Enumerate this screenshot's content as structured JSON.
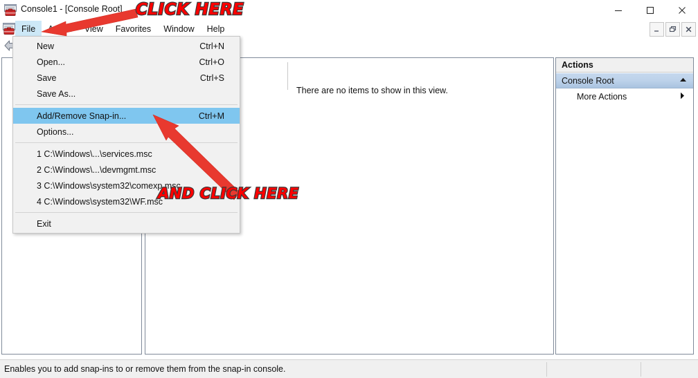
{
  "window": {
    "title": "Console1 - [Console Root]",
    "app_icon": "mmc-console-icon",
    "controls": {
      "minimize": "minimize-icon",
      "maximize": "maximize-icon",
      "close": "close-icon"
    },
    "mdi_controls": {
      "minimize": "–",
      "restore": "restore-icon",
      "close": "close-icon"
    }
  },
  "menubar": {
    "items": [
      {
        "label": "File",
        "state": "open"
      },
      {
        "label": "Action",
        "state": "normal"
      },
      {
        "label": "View",
        "state": "normal"
      },
      {
        "label": "Favorites",
        "state": "normal"
      },
      {
        "label": "Window",
        "state": "normal"
      },
      {
        "label": "Help",
        "state": "normal"
      }
    ]
  },
  "toolbar": {
    "back_icon": "back-arrow-icon",
    "folder_icon": "folder-icon"
  },
  "file_menu": {
    "groups": [
      {
        "items": [
          {
            "label": "New",
            "accel": "Ctrl+N",
            "selected": false
          },
          {
            "label": "Open...",
            "accel": "Ctrl+O",
            "selected": false
          },
          {
            "label": "Save",
            "accel": "Ctrl+S",
            "selected": false
          },
          {
            "label": "Save As...",
            "accel": "",
            "selected": false
          }
        ]
      },
      {
        "items": [
          {
            "label": "Add/Remove Snap-in...",
            "accel": "Ctrl+M",
            "selected": true
          },
          {
            "label": "Options...",
            "accel": "",
            "selected": false
          }
        ]
      },
      {
        "items": [
          {
            "label": "1 C:\\Windows\\...\\services.msc",
            "accel": "",
            "selected": false
          },
          {
            "label": "2 C:\\Windows\\...\\devmgmt.msc",
            "accel": "",
            "selected": false
          },
          {
            "label": "3 C:\\Windows\\system32\\comexp.msc",
            "accel": "",
            "selected": false
          },
          {
            "label": "4 C:\\Windows\\system32\\WF.msc",
            "accel": "",
            "selected": false
          }
        ]
      },
      {
        "items": [
          {
            "label": "Exit",
            "accel": "",
            "selected": false
          }
        ]
      }
    ]
  },
  "result_pane": {
    "empty_message": "There are no items to show in this view."
  },
  "actions_pane": {
    "title": "Actions",
    "group": {
      "label": "Console Root",
      "chevron": "▲"
    },
    "items": [
      {
        "label": "More Actions",
        "arrow": "▶"
      }
    ]
  },
  "statusbar": {
    "message": "Enables you to add snap-ins to or remove them from the snap-in console."
  },
  "annotations": [
    {
      "id": "anno1",
      "text": "CLICK HERE"
    },
    {
      "id": "anno2",
      "text": "AND CLICK HERE"
    }
  ],
  "colors": {
    "menu_selection": "#7fc6ef",
    "menubar_open": "#cde8f7",
    "annotation_red": "#ff0000",
    "actions_group_blue": "#bdd2ea",
    "pane_border": "#7f8a99"
  }
}
